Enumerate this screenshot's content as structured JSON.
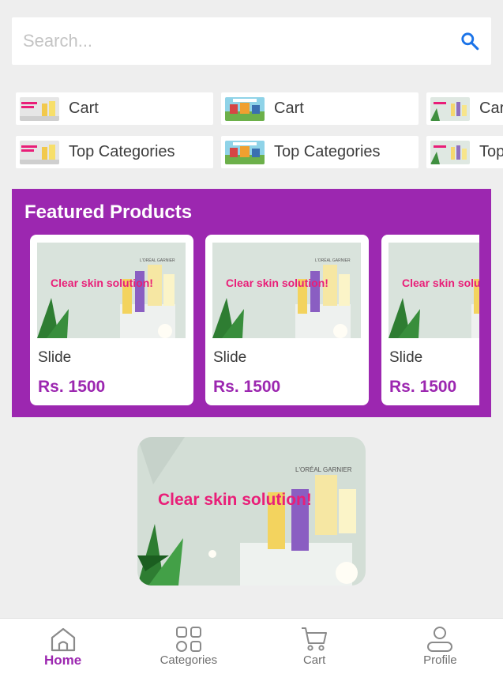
{
  "search": {
    "placeholder": "Search..."
  },
  "chips": {
    "row1": [
      "Cart",
      "Cart",
      "Cart"
    ],
    "row2": [
      "Top Categories",
      "Top Categories",
      "Top Categories"
    ]
  },
  "featured": {
    "title": "Featured Products",
    "products": [
      {
        "name": "Slide",
        "price": "Rs. 1500"
      },
      {
        "name": "Slide",
        "price": "Rs. 1500"
      },
      {
        "name": "Slide",
        "price": "Rs. 1500"
      }
    ],
    "promo_text": "Clear skin solution!",
    "brand_text": "L'ORÉAL GARNIER"
  },
  "banner": {
    "promo_text": "Clear skin solution!",
    "brand_text": "L'ORÉAL GARNIER"
  },
  "bottom_nav": {
    "items": [
      {
        "label": "Home",
        "icon": "home-icon",
        "active": true
      },
      {
        "label": "Categories",
        "icon": "categories-icon",
        "active": false
      },
      {
        "label": "Cart",
        "icon": "cart-icon",
        "active": false
      },
      {
        "label": "Profile",
        "icon": "profile-icon",
        "active": false
      }
    ]
  },
  "colors": {
    "accent": "#9c27b0",
    "search_icon": "#1a73e8",
    "background": "#eeeeee",
    "promo_pink": "#e91e78"
  }
}
